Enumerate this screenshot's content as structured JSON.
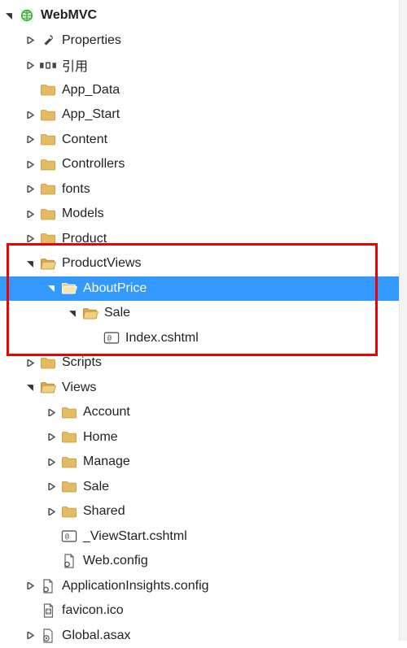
{
  "tree": {
    "root": "WebMVC",
    "nodes": {
      "properties": "Properties",
      "references": "引用",
      "app_data": "App_Data",
      "app_start": "App_Start",
      "content": "Content",
      "controllers": "Controllers",
      "fonts": "fonts",
      "models": "Models",
      "product": "Product",
      "productviews": "ProductViews",
      "aboutprice": "AboutPrice",
      "sale": "Sale",
      "index_cshtml": "Index.cshtml",
      "scripts": "Scripts",
      "views": "Views",
      "account": "Account",
      "home": "Home",
      "manage": "Manage",
      "sale2": "Sale",
      "shared": "Shared",
      "viewstart": "_ViewStart.cshtml",
      "webconfig": "Web.config",
      "appinsights": "ApplicationInsights.config",
      "favicon": "favicon.ico",
      "globalasax": "Global.asax"
    }
  },
  "colors": {
    "selection": "#3399ff",
    "highlight_border": "#e00000",
    "folder": "#e0b860"
  }
}
